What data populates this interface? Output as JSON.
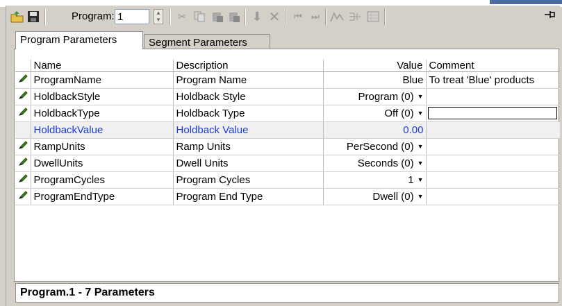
{
  "toolbar": {
    "program_label": "Program:",
    "program_value": "1",
    "icons": [
      "open-folder-icon",
      "save-icon",
      "cut-icon",
      "copy-icon",
      "paste-icon",
      "paste-special-icon",
      "insert-down-icon",
      "delete-icon",
      "first-icon",
      "last-icon",
      "chart-icon",
      "tree-icon",
      "grid-icon",
      "pin-icon"
    ]
  },
  "tabs": [
    {
      "label": "Program Parameters",
      "active": true
    },
    {
      "label": "Segment Parameters",
      "active": false
    }
  ],
  "table": {
    "headers": {
      "name": "Name",
      "description": "Description",
      "value": "Value",
      "comment": "Comment"
    },
    "rows": [
      {
        "name": "ProgramName",
        "description": "Program Name",
        "value": "Blue",
        "comment": "To treat 'Blue' products",
        "editable": true,
        "dropdown": false
      },
      {
        "name": "HoldbackStyle",
        "description": "Holdback Style",
        "value": "Program (0)",
        "comment": "",
        "editable": true,
        "dropdown": true
      },
      {
        "name": "HoldbackType",
        "description": "Holdback Type",
        "value": "Off (0)",
        "comment": "",
        "editable": true,
        "dropdown": true
      },
      {
        "name": "HoldbackValue",
        "description": "Holdback Value",
        "value": "0.00",
        "comment": "",
        "editable": false,
        "dropdown": false
      },
      {
        "name": "RampUnits",
        "description": "Ramp Units",
        "value": "PerSecond (0)",
        "comment": "",
        "editable": true,
        "dropdown": true
      },
      {
        "name": "DwellUnits",
        "description": "Dwell Units",
        "value": "Seconds (0)",
        "comment": "",
        "editable": true,
        "dropdown": true
      },
      {
        "name": "ProgramCycles",
        "description": "Program Cycles",
        "value": "1",
        "comment": "",
        "editable": true,
        "dropdown": true
      },
      {
        "name": "ProgramEndType",
        "description": "Program End Type",
        "value": "Dwell (0)",
        "comment": "",
        "editable": true,
        "dropdown": true
      }
    ]
  },
  "status": {
    "text": "Program.1  -  7 Parameters"
  }
}
